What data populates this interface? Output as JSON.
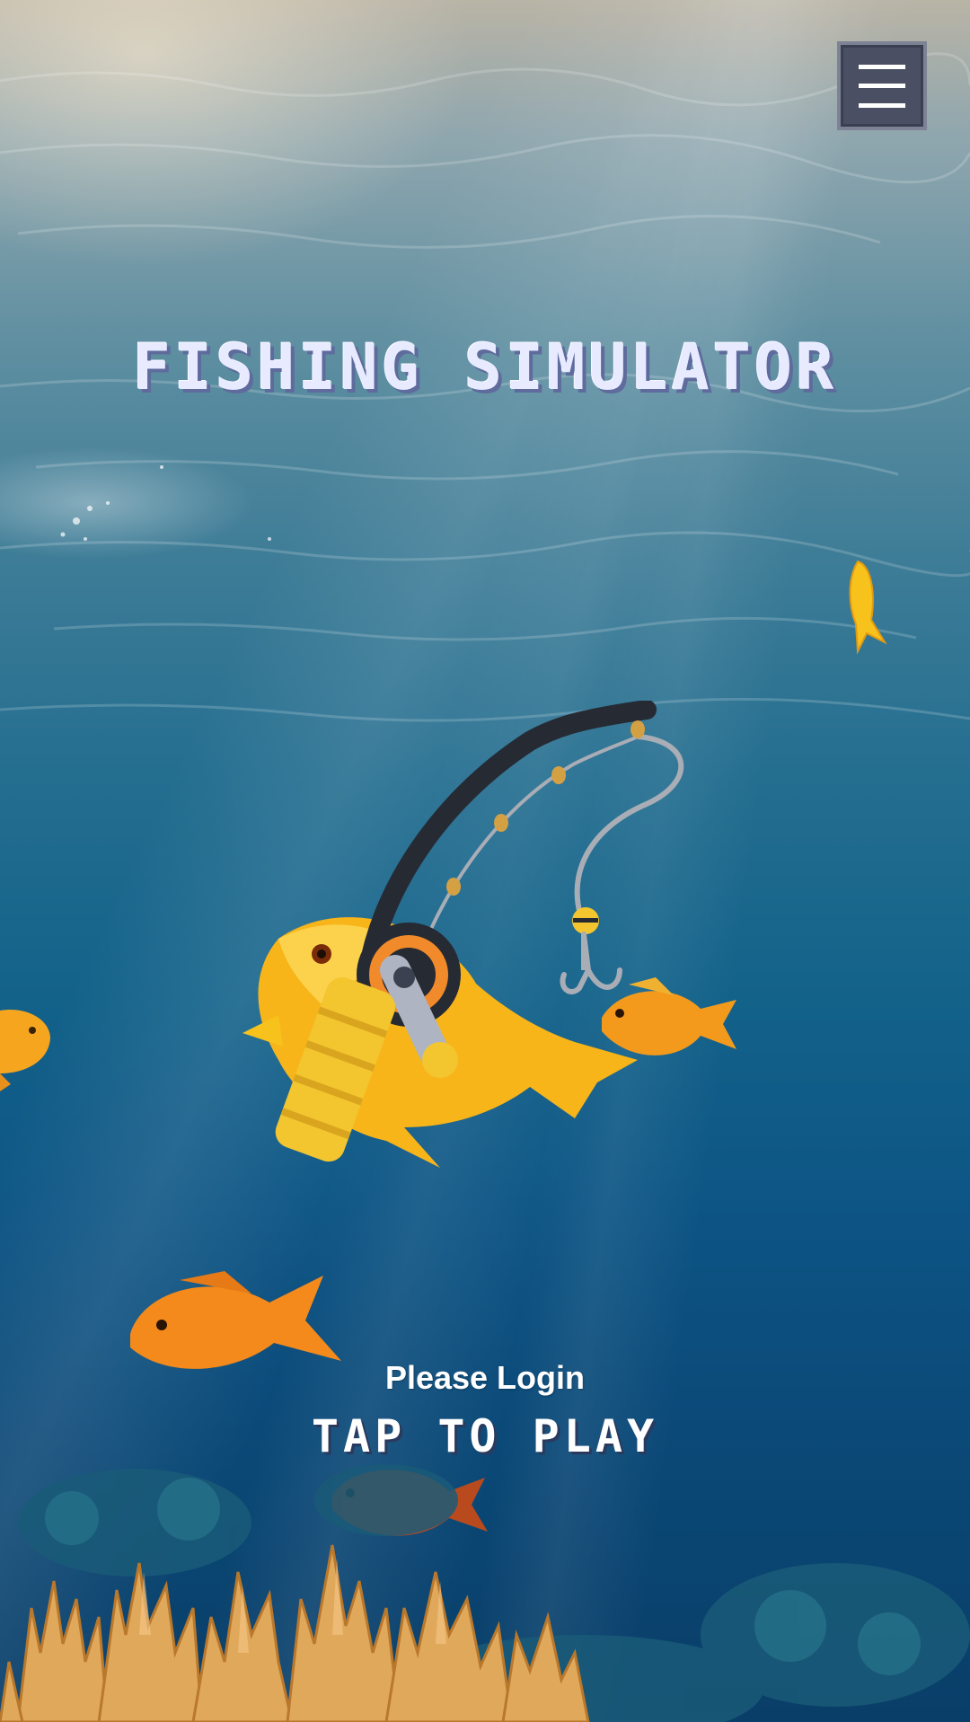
{
  "game": {
    "title": "FISHING SIMULATOR",
    "login_prompt": "Please Login",
    "tap_to_play": "TAP TO PLAY"
  },
  "menu": {
    "icon": "hamburger-menu-icon"
  },
  "colors": {
    "title_fill": "#e8ebff",
    "title_shadow": "#5e6b9c",
    "menu_bg": "#4a4f63",
    "water_top": "#b9b4a6",
    "water_deep": "#093e68",
    "fish_orange": "#f39a1d",
    "fish_yellow": "#f7c21b",
    "rod_handle": "#f3c52f",
    "coral": "#e0a85a"
  }
}
